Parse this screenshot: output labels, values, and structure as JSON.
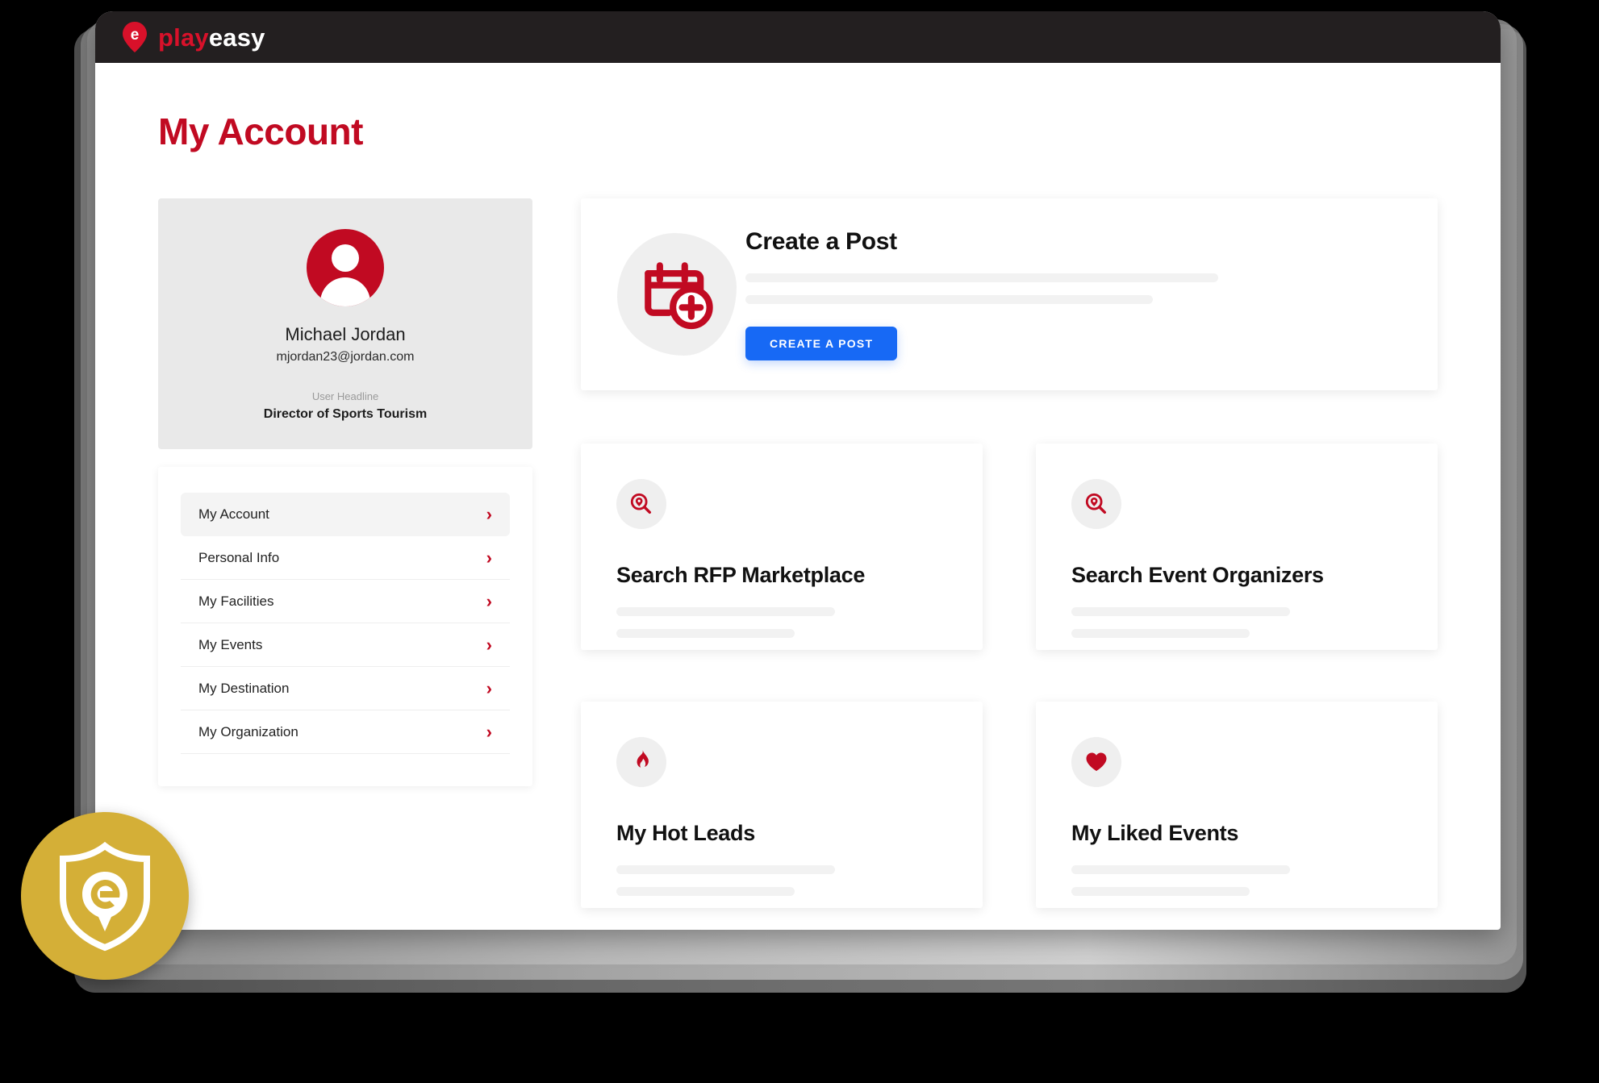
{
  "window": {
    "logo": {
      "play": "play",
      "easy": "easy",
      "pin_letter": "e"
    }
  },
  "page": {
    "title": "My Account"
  },
  "profile": {
    "avatar_icon": "user-avatar-icon",
    "name": "Michael Jordan",
    "email": "mjordan23@jordan.com",
    "headline_label": "User Headline",
    "headline_value": "Director of Sports Tourism"
  },
  "menu": {
    "items": [
      {
        "label": "My Account",
        "active": true,
        "chevron": "›"
      },
      {
        "label": "Personal Info",
        "active": false,
        "chevron": "›"
      },
      {
        "label": "My Facilities",
        "active": false,
        "chevron": "›"
      },
      {
        "label": "My Events",
        "active": false,
        "chevron": "›"
      },
      {
        "label": "My Destination",
        "active": false,
        "chevron": "›"
      },
      {
        "label": "My Organization",
        "active": false,
        "chevron": "›"
      }
    ]
  },
  "create_post": {
    "icon": "calendar-plus-icon",
    "title": "Create a Post",
    "button_label": "CREATE A POST"
  },
  "tiles": [
    {
      "icon": "search-pin-icon",
      "title": "Search RFP Marketplace"
    },
    {
      "icon": "search-pin-icon",
      "title": "Search Event Organizers"
    },
    {
      "icon": "flame-icon",
      "title": "My Hot Leads"
    },
    {
      "icon": "heart-icon",
      "title": "My Liked Events"
    }
  ],
  "seal": {
    "icon": "shield-pin-seal-icon"
  },
  "colors": {
    "brand_red": "#c10a22",
    "dark_header": "#231f20",
    "button_blue": "#1769f5",
    "seal_gold": "#d4af37",
    "placeholder_gray": "#f2f2f2"
  }
}
